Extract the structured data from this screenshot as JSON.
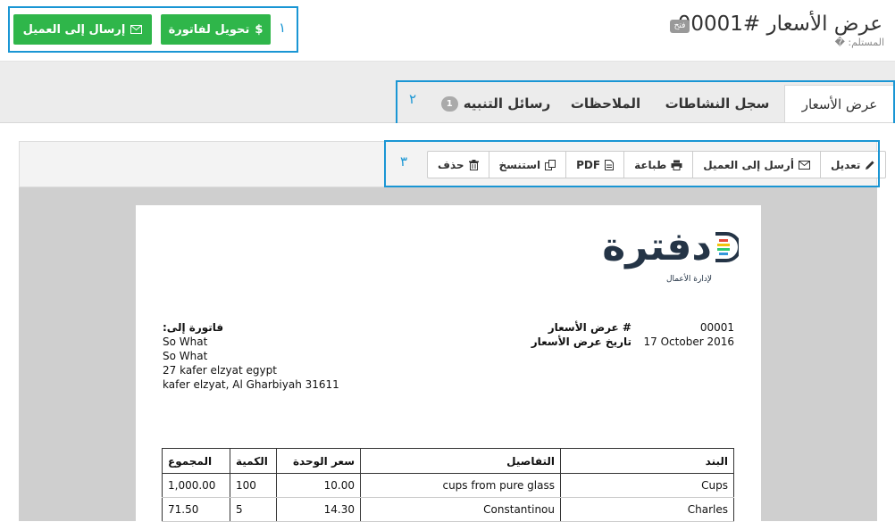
{
  "header": {
    "title": "عرض الأسعار #00001",
    "title_badge": "فتح",
    "subtitle": "المستلم: �"
  },
  "actions": {
    "convert_label": "تحويل لفاتورة",
    "convert_icon": "$",
    "send_label": "إرسال إلى العميل"
  },
  "annotations": {
    "n1": "١",
    "n2": "٢",
    "n3": "٣"
  },
  "tabs": [
    {
      "label": "عرض الأسعار",
      "active": true
    },
    {
      "label": "سجل النشاطات"
    },
    {
      "label": "الملاحظات"
    },
    {
      "label": "رسائل التنبيه",
      "count": "1"
    }
  ],
  "toolbar": {
    "edit": "تعديل",
    "send": "أرسل إلى العميل",
    "print": "طباعة",
    "pdf": "PDF",
    "copy": "استنسخ",
    "delete": "حذف"
  },
  "document": {
    "logo_text": "دفترة",
    "logo_tagline": "لإدارة الأعمال",
    "estimate_number_label": "# عرض الأسعار",
    "estimate_number": "00001",
    "estimate_date_label": "تاريخ عرض الأسعار",
    "estimate_date": "17 October 2016",
    "bill_to_label": "فاتورة إلى:",
    "client_lines": [
      "So What",
      "So What",
      "27 kafer elzyat egypt",
      "kafer elzyat, Al Gharbiyah 31611"
    ],
    "table": {
      "headers": {
        "item": "البند",
        "details": "التفاصيل",
        "unit_price": "سعر الوحدة",
        "qty": "الكمية",
        "total": "المجموع"
      },
      "rows": [
        {
          "item": "Cups",
          "details": "cups from pure glass",
          "unit_price": "10.00",
          "qty": "100",
          "total": "1,000.00"
        },
        {
          "item": "Charles",
          "details": "Constantinou",
          "unit_price": "14.30",
          "qty": "5",
          "total": "71.50"
        }
      ]
    }
  },
  "colors": {
    "accent_green": "#2fb64a",
    "annotation_blue": "#1a96d4",
    "logo_navy": "#243446"
  }
}
